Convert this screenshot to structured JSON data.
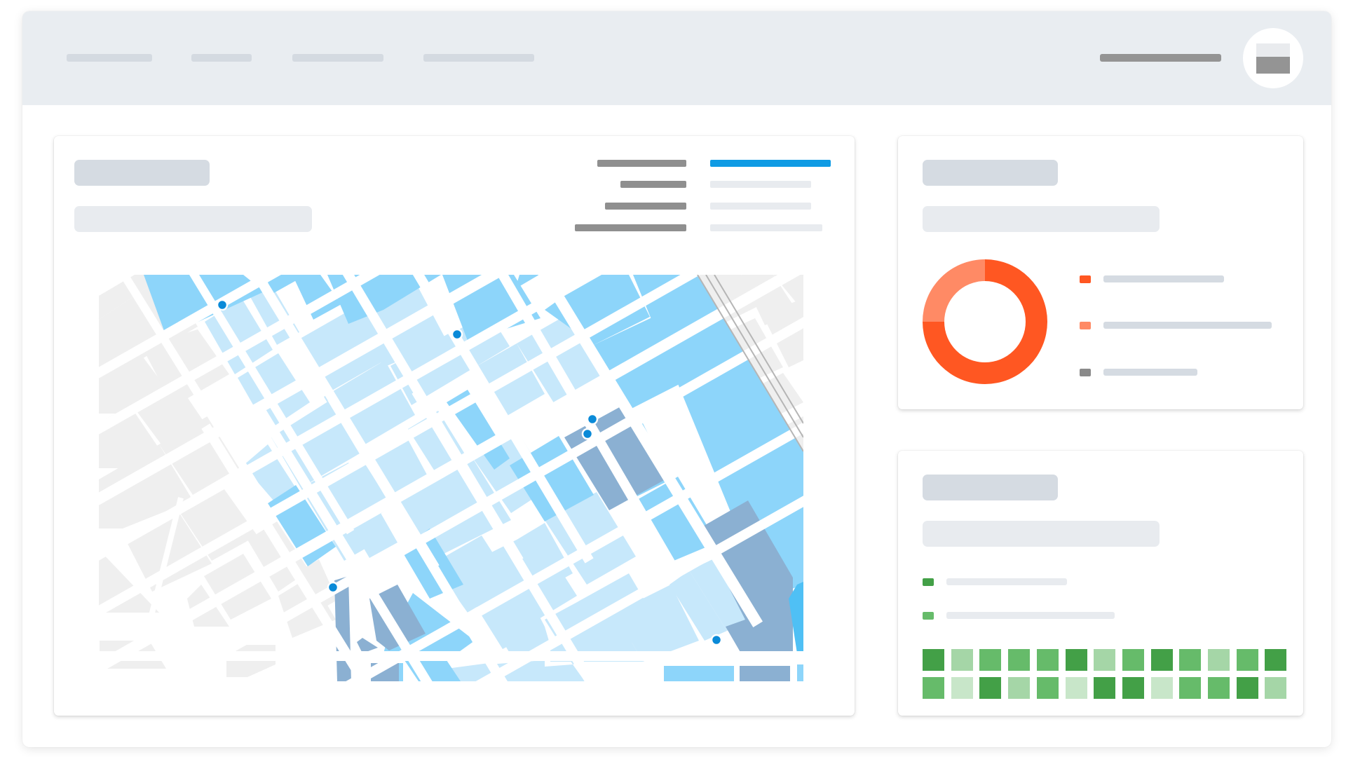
{
  "app": {
    "nav_items": [
      "",
      "",
      "",
      ""
    ],
    "user_name": "",
    "avatar": "user-avatar-icon"
  },
  "map_card": {
    "title": "",
    "subtitle": "",
    "legend": [
      {
        "label": "",
        "value": "",
        "active": true
      },
      {
        "label": "",
        "value": "",
        "active": false
      },
      {
        "label": "",
        "value": "",
        "active": false
      },
      {
        "label": "",
        "value": "",
        "active": false
      }
    ],
    "map": {
      "zone_colors": {
        "neutral": "#efefef",
        "level_1": "#c7e8fb",
        "level_2": "#8dd5fa",
        "level_3": "#8bb0d2",
        "water": "#4fc0f5"
      },
      "marker_color": "#0a8ad8",
      "marker_count": 7
    }
  },
  "donut_card": {
    "title": "",
    "subtitle": "",
    "chart_data": {
      "type": "pie",
      "title": "",
      "categories": [
        "",
        "",
        ""
      ],
      "values": [
        75,
        25,
        0
      ],
      "colors": [
        "#ff5722",
        "#ff8a65",
        "#8a8a8a"
      ]
    },
    "legend_colors": [
      "#ff5722",
      "#ff8a65",
      "#8a8a8a"
    ]
  },
  "heatmap_card": {
    "title": "",
    "subtitle": "",
    "legend_colors": [
      "#43a047",
      "#66bb6a"
    ],
    "palette": [
      "#c8e6c9",
      "#a5d6a7",
      "#66bb6a",
      "#43a047"
    ],
    "rows": [
      [
        3,
        1,
        2,
        2,
        2,
        3,
        1,
        2,
        3,
        2,
        1,
        2,
        3
      ],
      [
        2,
        0,
        3,
        1,
        2,
        0,
        3,
        3,
        0,
        2,
        2,
        3,
        1
      ]
    ]
  }
}
